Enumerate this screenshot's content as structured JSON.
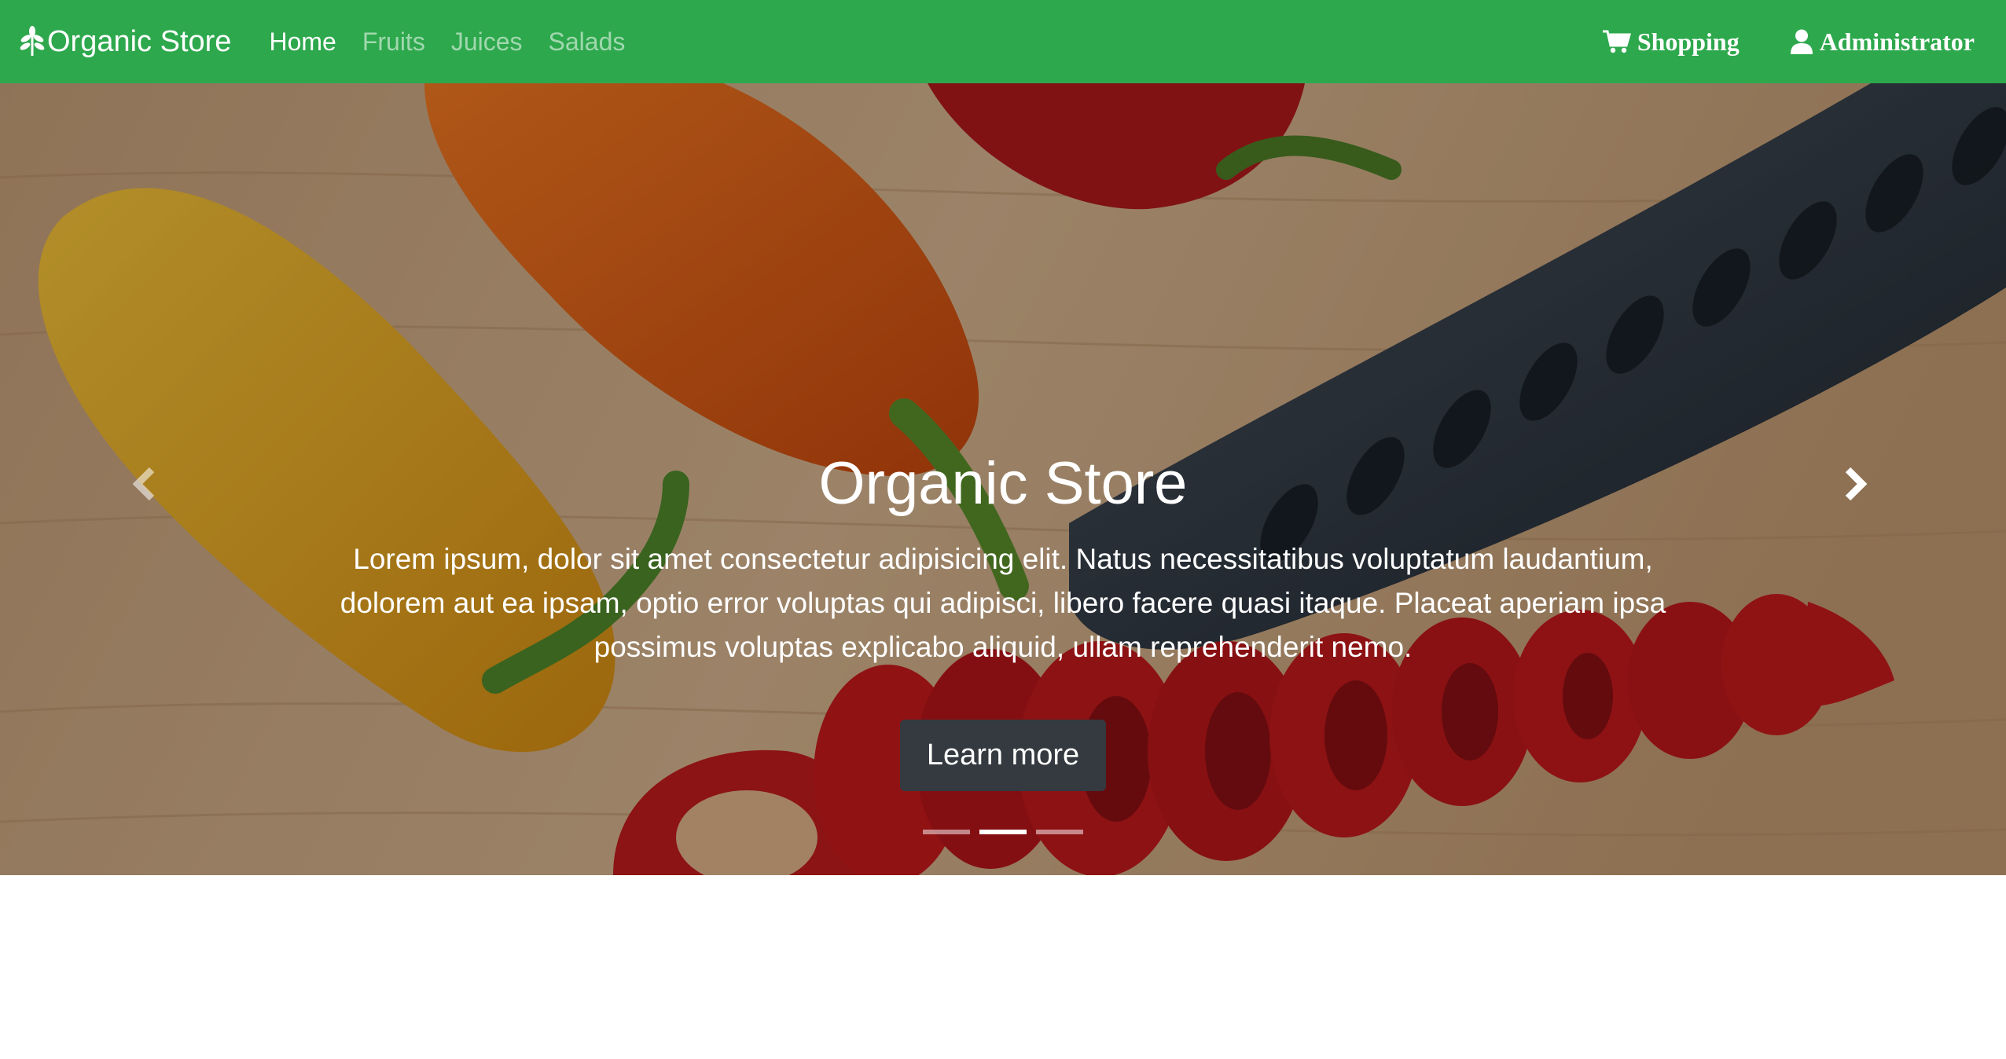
{
  "navbar": {
    "brand": "Organic Store",
    "links": [
      {
        "label": "Home",
        "active": true
      },
      {
        "label": "Fruits",
        "active": false
      },
      {
        "label": "Juices",
        "active": false
      },
      {
        "label": "Salads",
        "active": false
      }
    ],
    "right": {
      "shopping_label": "Shopping",
      "admin_label": "Administrator"
    },
    "color": "#2ea84d"
  },
  "carousel": {
    "title": "Organic Store",
    "text": "Lorem ipsum, dolor sit amet consectetur adipisicing elit. Natus necessitatibus voluptatum laudantium, dolorem aut ea ipsam, optio error voluptas qui adipisci, libero facere quasi itaque. Placeat aperiam ipsa possimus voluptas explicabo aliquid, ullam reprehenderit nemo.",
    "button_label": "Learn more",
    "button_color": "#343a40",
    "slide_count": 3,
    "active_slide": 2,
    "prev_icon": "chevron-left-icon",
    "next_icon": "chevron-right-icon"
  }
}
